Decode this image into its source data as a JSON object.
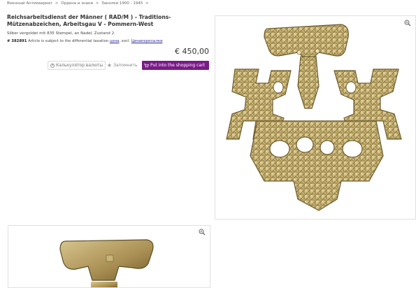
{
  "breadcrumb": [
    "Военный Антиквариат",
    "Ордена и знаки",
    "Заколки 1900 - 1945"
  ],
  "breadcrumb_sep": ">",
  "product": {
    "title": "Reichsarbeitsdienst der Männer ( RAD/M ) - Traditions-Mützenabzeichen, Arbeitsgau V - Pommern-West",
    "description": "Silber vergoldet mit 835 Stempel, an Nadel, Zustand 2.",
    "article_no": "# 382891",
    "tax_text": "Article is subject to the differential taxation",
    "tax_link": "цена",
    "excl_text": ", excl.",
    "shipping_link": "Цинапересылки",
    "price": "€ 450,00"
  },
  "buttons": {
    "calc": "Калькулятор валюты",
    "remember": "Запомнить",
    "cart": "Put into the shopping cart"
  },
  "icons": {
    "calc": "currency-calculator-icon",
    "remember": "star-icon",
    "cart": "shopping-cart-icon",
    "zoom": "zoom-icon"
  },
  "colors": {
    "accent": "#7a1a88",
    "metal": "#c9b57a"
  }
}
